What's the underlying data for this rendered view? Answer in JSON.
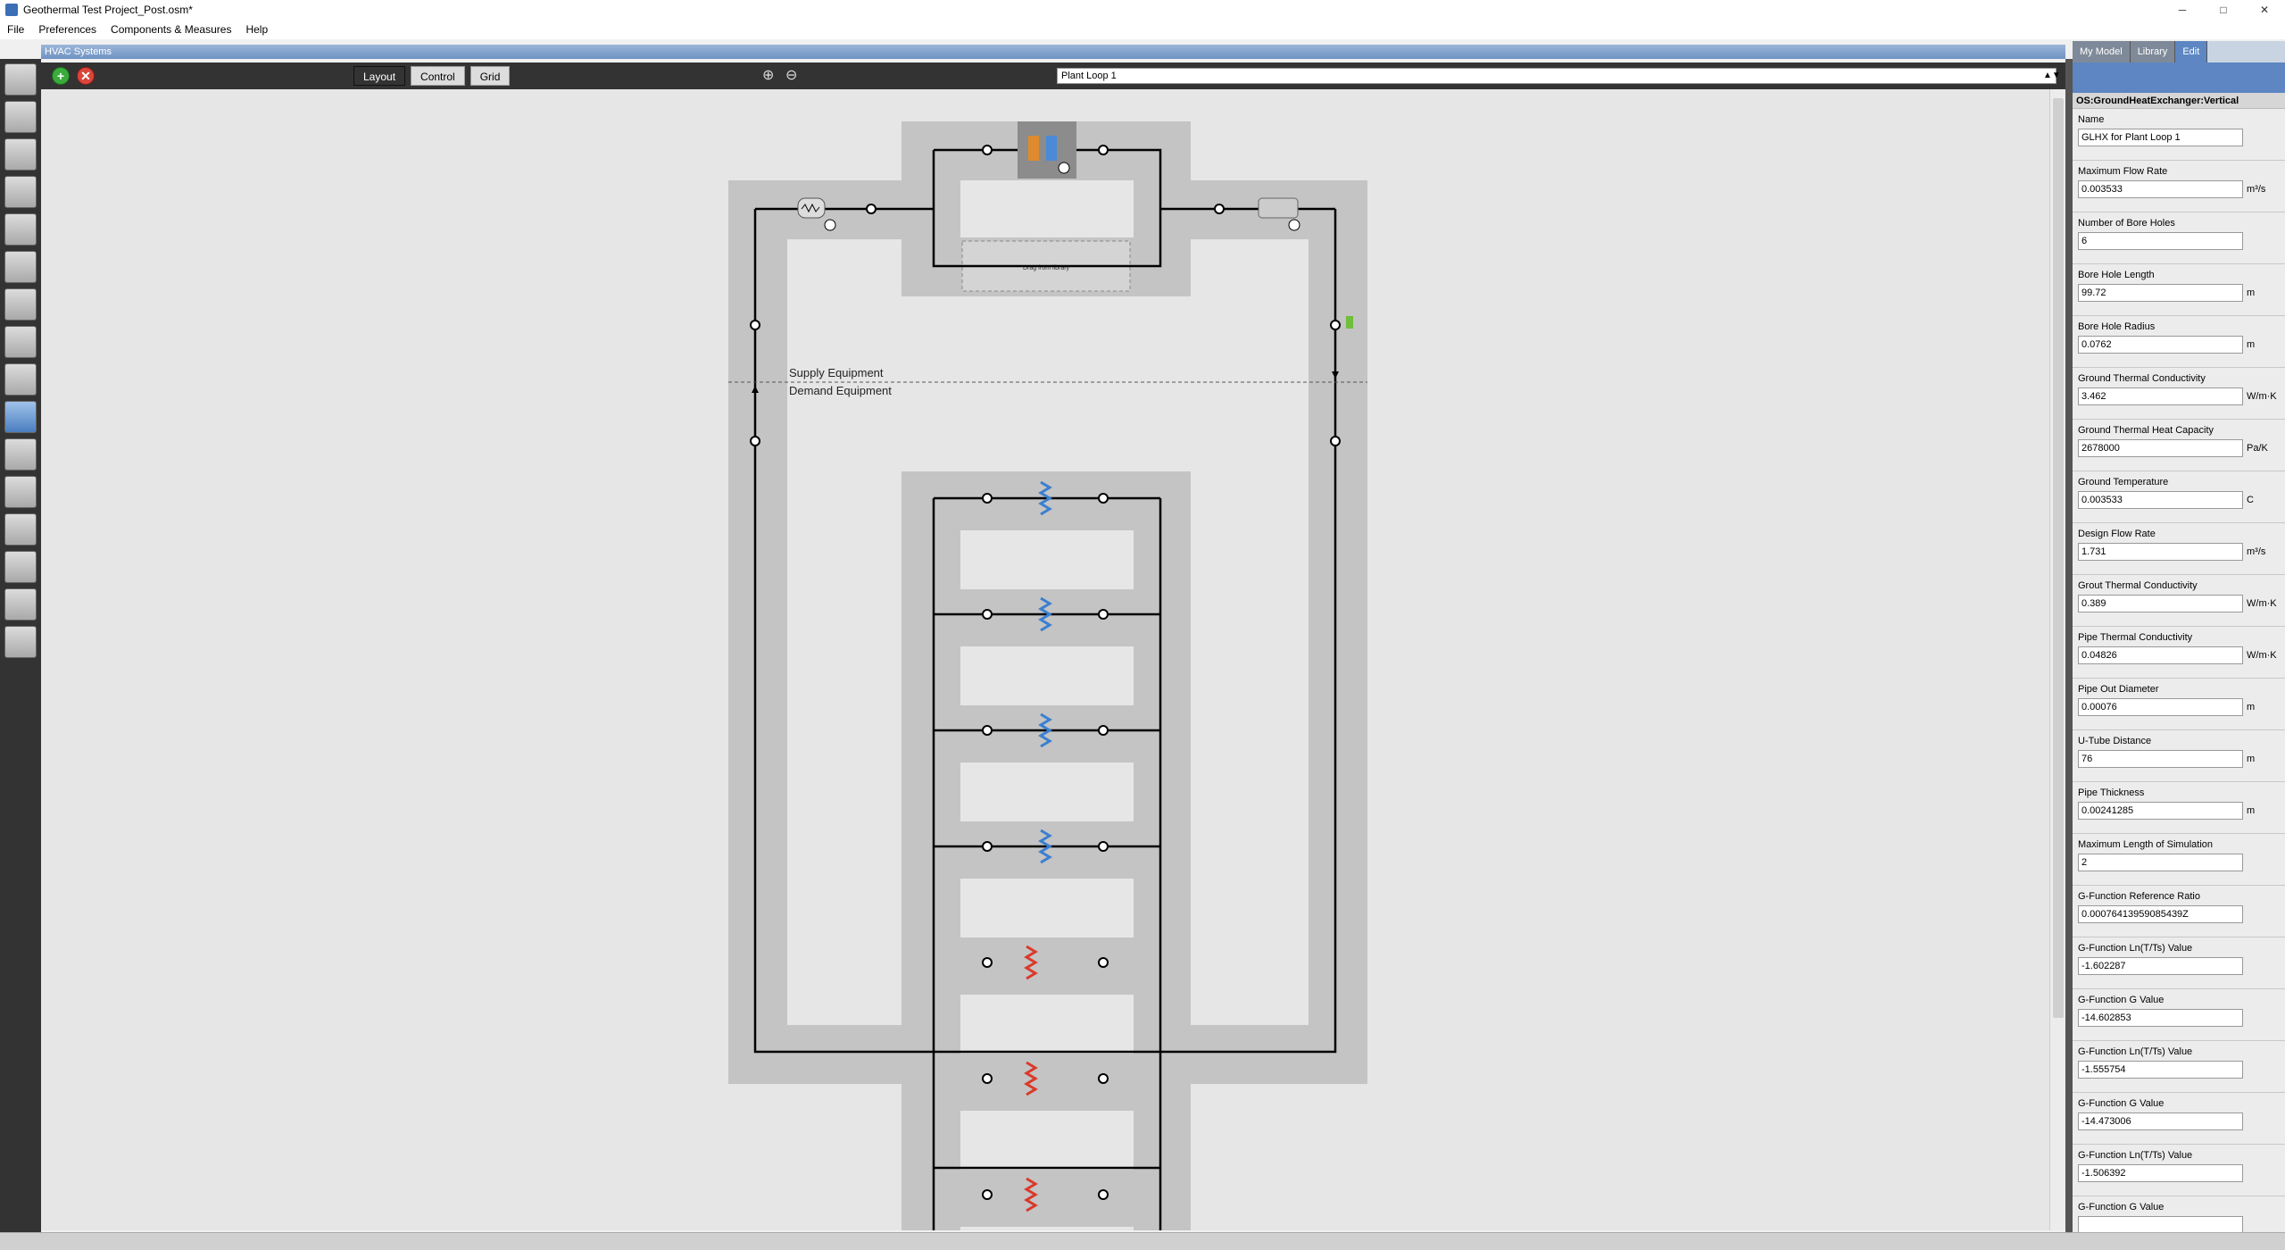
{
  "window": {
    "title": "Geothermal Test Project_Post.osm*",
    "minimize": "─",
    "maximize": "□",
    "close": "✕"
  },
  "menu": [
    {
      "label": "File"
    },
    {
      "label": "Preferences"
    },
    {
      "label": "Components & Measures"
    },
    {
      "label": "Help"
    }
  ],
  "header": {
    "title": "HVAC Systems"
  },
  "right_tabs": [
    {
      "label": "My Model"
    },
    {
      "label": "Library"
    },
    {
      "label": "Edit"
    }
  ],
  "toolbar": {
    "add_label": "+",
    "delete_label": "✕",
    "layout_label": "Layout",
    "control_label": "Control",
    "grid_label": "Grid",
    "zoom_in_icon": "zoom-in-icon",
    "zoom_out_icon": "zoom-out-icon",
    "loop_selected": "Plant Loop 1"
  },
  "diagram": {
    "supply_label": "Supply Equipment",
    "demand_label": "Demand Equipment",
    "drop_zone_label": "Drag from library"
  },
  "inspector": {
    "object_type": "OS:GroundHeatExchanger:Vertical",
    "fields": [
      {
        "label": "Name",
        "value": "GLHX for Plant Loop 1",
        "unit": ""
      },
      {
        "label": "Maximum Flow Rate",
        "value": "0.003533",
        "unit": "m³/s"
      },
      {
        "label": "Number of Bore Holes",
        "value": "6",
        "unit": ""
      },
      {
        "label": "Bore Hole Length",
        "value": "99.72",
        "unit": "m"
      },
      {
        "label": "Bore Hole Radius",
        "value": "0.0762",
        "unit": "m"
      },
      {
        "label": "Ground Thermal Conductivity",
        "value": "3.462",
        "unit": "W/m·K"
      },
      {
        "label": "Ground Thermal Heat Capacity",
        "value": "2678000",
        "unit": "Pa/K"
      },
      {
        "label": "Ground Temperature",
        "value": "0.003533",
        "unit": "C"
      },
      {
        "label": "Design Flow Rate",
        "value": "1.731",
        "unit": "m³/s"
      },
      {
        "label": "Grout Thermal Conductivity",
        "value": "0.389",
        "unit": "W/m·K"
      },
      {
        "label": "Pipe Thermal Conductivity",
        "value": "0.04826",
        "unit": "W/m·K"
      },
      {
        "label": "Pipe Out Diameter",
        "value": "0.00076",
        "unit": "m"
      },
      {
        "label": "U-Tube Distance",
        "value": "76",
        "unit": "m"
      },
      {
        "label": "Pipe Thickness",
        "value": "0.00241285",
        "unit": "m"
      },
      {
        "label": "Maximum Length of Simulation",
        "value": "2",
        "unit": ""
      },
      {
        "label": "G-Function Reference Ratio",
        "value": "0.00076413959085439Z",
        "unit": ""
      },
      {
        "label": "G-Function Ln(T/Ts) Value",
        "value": "-1.602287",
        "unit": ""
      },
      {
        "label": "G-Function G Value",
        "value": "-14.602853",
        "unit": ""
      },
      {
        "label": "G-Function Ln(T/Ts) Value",
        "value": "-1.555754",
        "unit": ""
      },
      {
        "label": "G-Function G Value",
        "value": "-14.473006",
        "unit": ""
      },
      {
        "label": "G-Function Ln(T/Ts) Value",
        "value": "-1.506392",
        "unit": ""
      },
      {
        "label": "G-Function G Value",
        "value": "",
        "unit": ""
      }
    ]
  },
  "colors": {
    "accent": "#5d86c2",
    "toolbar_dark": "#333333",
    "canvas_bg": "#e6e6e6",
    "loop_band": "#bfbfbf"
  }
}
